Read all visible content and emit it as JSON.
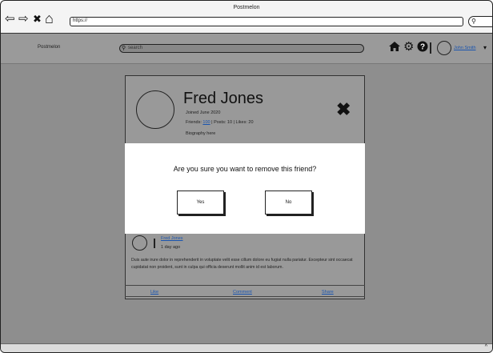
{
  "window": {
    "title": "Postmelon"
  },
  "browser": {
    "back_glyph": "⇦",
    "forward_glyph": "⇨",
    "close_glyph": "✖",
    "home_glyph": "⌂",
    "address": "https://",
    "search_glyph": "⚲"
  },
  "header": {
    "brand": "Postmelon",
    "search_placeholder": "search",
    "search_glyph": "⚲",
    "home_icon": "home-icon",
    "home_glyph": "🏠",
    "settings_glyph": "⚙",
    "help_glyph": "?",
    "user_name": "John Smith",
    "caret": "▾"
  },
  "profile": {
    "name": "Fred Jones",
    "joined": "Joined June 2020",
    "friends_label": "Friends: ",
    "friends_count": "100",
    "stats_rest": " | Posts: 10 | Likes: 20",
    "bio": "Biography here",
    "close_glyph": "✖"
  },
  "dialog": {
    "question": "Are you sure you want to remove this friend?",
    "yes": "Yes",
    "no": "No"
  },
  "post": {
    "author": "Fred Jones",
    "time": "1 day ago",
    "body": "Duis aute irure dolor in reprehenderit in voluptate velit esse cillum dolore eu fugiat nulla pariatur. Excepteur sint occaecat cupidatat non proident, sunt in culpa qui officia deserunt mollit anim id est laborum.",
    "actions": {
      "like": "Like",
      "comment": "Comment",
      "share": "Share"
    }
  },
  "footer": {
    "caret": "^"
  }
}
